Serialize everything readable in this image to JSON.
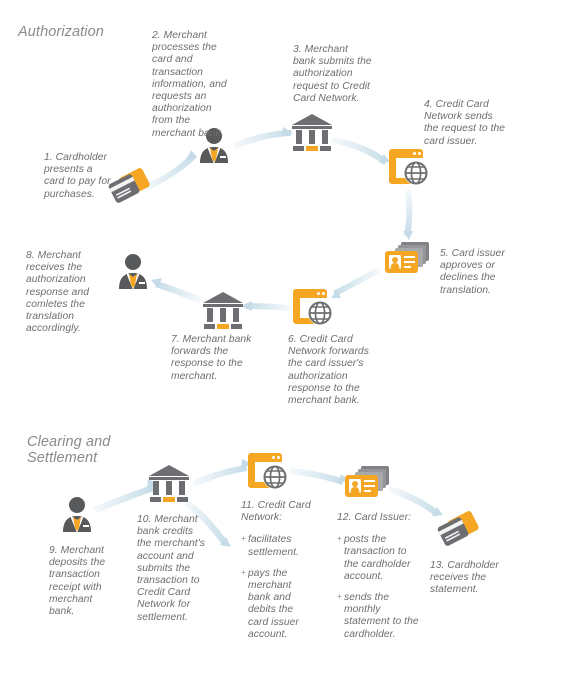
{
  "diagram": {
    "title_authorization": "Authorization",
    "title_clearing": "Clearing and\nSettlement"
  },
  "colors": {
    "orange": "#F5A623",
    "orange_light": "#F7B34A",
    "gray_dark": "#58595B",
    "gray_icon": "#6D6E71",
    "text_gray": "#6E6E6E",
    "heading_gray": "#8A8A8A",
    "arrow_blue": "#C5DCE8",
    "background": "#FFFFFF"
  },
  "authorization": {
    "steps": [
      {
        "number": "1",
        "icon": "credit-card-icon",
        "text": "1. Cardholder presents a card to pay for purchases."
      },
      {
        "number": "2",
        "icon": "merchant-person-icon",
        "text": "2. Merchant processes the card and transaction information, and requests an authorization from the merchant bank."
      },
      {
        "number": "3",
        "icon": "bank-icon",
        "text": "3. Merchant bank submits the authorization request to Credit Card Network."
      },
      {
        "number": "4",
        "icon": "network-globe-icon",
        "text": "4. Credit Card Network sends the request to the card issuer."
      },
      {
        "number": "5",
        "icon": "card-issuer-icon",
        "text": "5. Card issuer approves or declines the translation."
      },
      {
        "number": "6",
        "icon": "network-globe-icon",
        "text": "6. Credit Card Network forwards the card issuer's authorization response to the merchant bank."
      },
      {
        "number": "7",
        "icon": "bank-icon",
        "text": "7. Merchant bank forwards the response to the merchant."
      },
      {
        "number": "8",
        "icon": "merchant-person-icon",
        "text": "8. Merchant receives the authorization response and comletes the translation accordingly."
      }
    ]
  },
  "clearing": {
    "steps": [
      {
        "number": "9",
        "icon": "merchant-person-icon",
        "text": "9. Merchant deposits the transaction receipt with merchant bank."
      },
      {
        "number": "10",
        "icon": "bank-icon",
        "text": "10. Merchant bank credits the merchant's account and submits the transaction to Credit Card Network for settlement."
      },
      {
        "number": "11",
        "icon": "network-globe-icon",
        "heading": "11. Credit Card Network:",
        "bullets": [
          "facilitates settlement.",
          "pays the merchant bank and debits the card issuer account."
        ]
      },
      {
        "number": "12",
        "icon": "card-issuer-icon",
        "heading": "12. Card Issuer:",
        "bullets": [
          "posts the transaction to the cardholder account.",
          "sends the monthly statement to the cardholder."
        ]
      },
      {
        "number": "13",
        "icon": "credit-card-icon",
        "text": "13. Cardholder receives the statement."
      }
    ]
  }
}
